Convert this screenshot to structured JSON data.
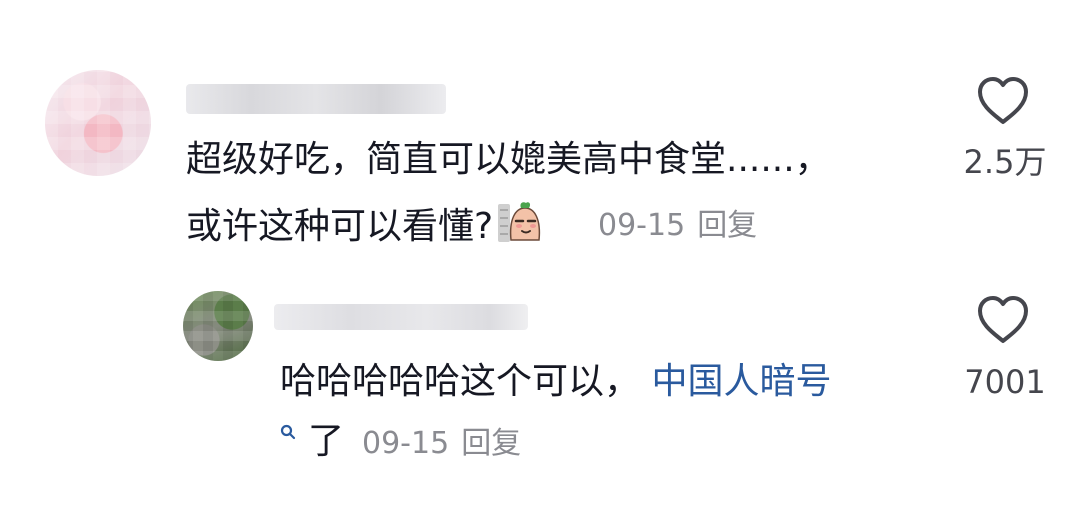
{
  "comments": [
    {
      "username": "",
      "text_line1": "超级好吃，简直可以媲美高中食堂......，",
      "text_line2": "或许这种可以看懂?",
      "emoji": "smug-face-emoji",
      "date": "09-15",
      "reply_label": "回复",
      "likes": "2.5万"
    },
    {
      "username": "",
      "text_main": "哈哈哈哈哈这个可以，",
      "text_link": "中国人暗号",
      "text_trailing": "了",
      "date": "09-15",
      "reply_label": "回复",
      "likes": "7001"
    }
  ],
  "colors": {
    "text": "#161823",
    "meta": "#8a8b91",
    "link": "#2a5a9e",
    "heart_stroke": "#45464d"
  },
  "icons": {
    "like": "heart-outline-icon",
    "search_hint": "search-icon"
  }
}
